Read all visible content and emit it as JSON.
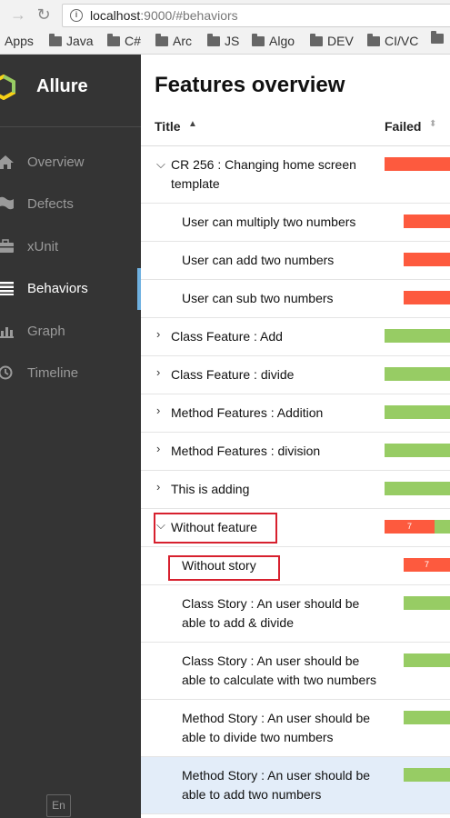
{
  "browser": {
    "url_host": "localhost",
    "url_rest": ":9000/#behaviors",
    "bookmarks": [
      "Apps",
      "Java",
      "C#",
      "Arc",
      "JS",
      "Algo",
      "DEV",
      "CI/VC"
    ]
  },
  "sidebar": {
    "brand": "Allure",
    "items": [
      {
        "label": "Overview",
        "icon": "home-icon"
      },
      {
        "label": "Defects",
        "icon": "flag-icon"
      },
      {
        "label": "xUnit",
        "icon": "briefcase-icon"
      },
      {
        "label": "Behaviors",
        "icon": "list-icon"
      },
      {
        "label": "Graph",
        "icon": "bar-chart-icon"
      },
      {
        "label": "Timeline",
        "icon": "clock-icon"
      }
    ],
    "active": "Behaviors",
    "language": "En"
  },
  "main": {
    "title": "Features overview",
    "columns": {
      "title": "Title",
      "failed": "Failed"
    },
    "rows": [
      {
        "label": "CR 256 : Changing home screen template",
        "level": 0,
        "expanded": true,
        "status": "failed",
        "count": ""
      },
      {
        "label": "User can multiply two numbers",
        "level": 1,
        "status": "failed",
        "count": ""
      },
      {
        "label": "User can add two numbers",
        "level": 1,
        "status": "failed",
        "count": ""
      },
      {
        "label": "User can sub two numbers",
        "level": 1,
        "status": "failed",
        "count": ""
      },
      {
        "label": "Class Feature : Add",
        "level": 0,
        "expanded": false,
        "status": "passed"
      },
      {
        "label": "Class Feature : divide",
        "level": 0,
        "expanded": false,
        "status": "passed"
      },
      {
        "label": "Method Features : Addition",
        "level": 0,
        "expanded": false,
        "status": "passed"
      },
      {
        "label": "Method Features : division",
        "level": 0,
        "expanded": false,
        "status": "passed"
      },
      {
        "label": "This is adding",
        "level": 0,
        "expanded": false,
        "status": "passed"
      },
      {
        "label": "Without feature",
        "level": 0,
        "expanded": true,
        "status": "mixed",
        "count": "7"
      },
      {
        "label": "Without story",
        "level": 1,
        "status": "failed",
        "count": "7"
      },
      {
        "label": "Class Story : An user should be able to add & divide",
        "level": 1,
        "status": "passed"
      },
      {
        "label": "Class Story : An user should be able to calculate with two numbers",
        "level": 1,
        "status": "passed"
      },
      {
        "label": "Method Story : An user should be able to divide two numbers",
        "level": 1,
        "status": "passed"
      },
      {
        "label": "Method Story : An user should be able to add two numbers",
        "level": 1,
        "status": "passed",
        "selected": true
      }
    ]
  },
  "colors": {
    "failed": "#fd5a3e",
    "passed": "#97cc64",
    "sidebar_bg": "#343434",
    "active_indicator": "#6eb0e0",
    "annotation": "#d7202e"
  }
}
